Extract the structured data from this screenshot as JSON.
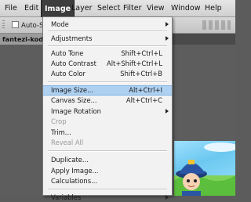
{
  "menubar": {
    "items": [
      "File",
      "Edit",
      "Image",
      "Layer",
      "Select",
      "Filter",
      "View",
      "Window",
      "Help"
    ]
  },
  "options_bar": {
    "auto_select_label": "Auto-S"
  },
  "document": {
    "tab_label": "fantezi-koda"
  },
  "image_menu": {
    "mode": "Mode",
    "adjustments": "Adjustments",
    "auto_tone": "Auto Tone",
    "auto_tone_sc": "Shift+Ctrl+L",
    "auto_contrast": "Auto Contrast",
    "auto_contrast_sc": "Alt+Shift+Ctrl+L",
    "auto_color": "Auto Color",
    "auto_color_sc": "Shift+Ctrl+B",
    "image_size": "Image Size...",
    "image_size_sc": "Alt+Ctrl+I",
    "canvas_size": "Canvas Size...",
    "canvas_size_sc": "Alt+Ctrl+C",
    "image_rotation": "Image Rotation",
    "crop": "Crop",
    "trim": "Trim...",
    "reveal_all": "Reveal All",
    "duplicate": "Duplicate...",
    "apply_image": "Apply Image...",
    "calculations": "Calculations...",
    "variables": "Variables"
  },
  "colors": {
    "menu_highlight": "#aed1f2",
    "active_menu": "#3d3d3d",
    "disabled_text": "#9a9a9a"
  }
}
